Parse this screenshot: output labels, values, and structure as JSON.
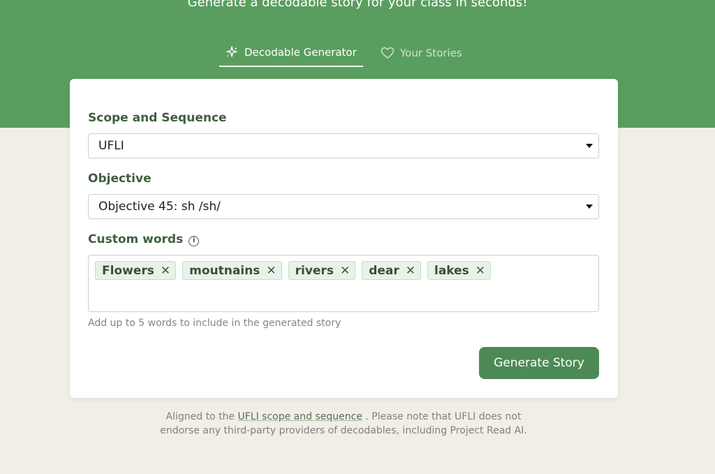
{
  "hero": {
    "tagline": "Generate a decodable story for your class in seconds!",
    "bg_color": "#5a9e5f"
  },
  "tabs": [
    {
      "label": "Decodable Generator",
      "icon": "sparkles-icon",
      "active": true
    },
    {
      "label": "Your Stories",
      "icon": "heart-icon",
      "active": false
    }
  ],
  "form": {
    "scope_label": "Scope and Sequence",
    "scope_value": "UFLI",
    "objective_label": "Objective",
    "objective_value": "Objective 45: sh /sh/",
    "custom_words_label": "Custom words",
    "custom_words": [
      "Flowers",
      "moutnains",
      "rivers",
      "dear",
      "lakes"
    ],
    "helper_text": "Add up to 5 words to include in the generated story",
    "generate_label": "Generate Story"
  },
  "footer": {
    "prefix": "Aligned to the",
    "link": "UFLI scope and sequence",
    "line1_suffix": ". Please note that UFLI does not",
    "line2": "endorse any third-party providers of decodables, including Project Read AI."
  },
  "colors": {
    "accent": "#4e8a55",
    "page_bg": "#f1eee6",
    "chip_bg": "#e8f2e8"
  }
}
